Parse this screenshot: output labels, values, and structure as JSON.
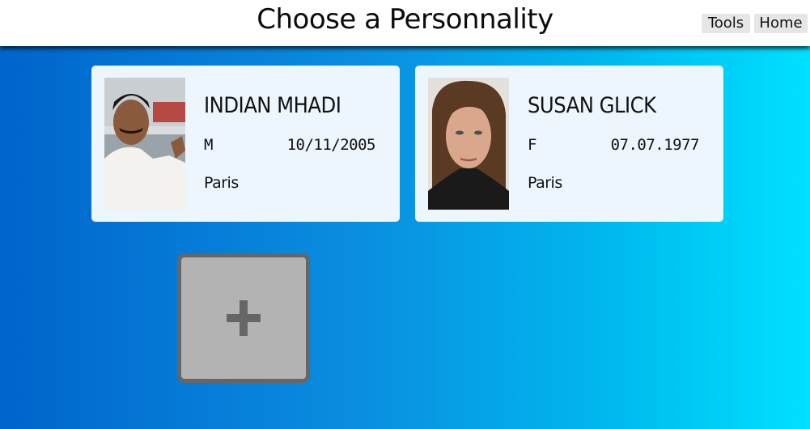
{
  "header": {
    "title": "Choose a Personnality",
    "nav": {
      "tools_label": "Tools",
      "home_label": "Home"
    }
  },
  "personalities": [
    {
      "name": "INDIAN MHADI",
      "sex": "M",
      "dob": "10/11/2005",
      "city": "Paris",
      "photo": "man-portrait"
    },
    {
      "name": "SUSAN GLICK",
      "sex": "F",
      "dob": "07.07.1977",
      "city": "Paris",
      "photo": "woman-portrait"
    }
  ],
  "add_tile": {
    "icon": "plus-icon"
  },
  "colors": {
    "header_bg": "#ffffff",
    "card_bg": "#edf5fd",
    "gradient_start": "#0064cc",
    "gradient_end": "#00e0ff",
    "add_tile_bg": "#b3b3b3",
    "add_tile_border": "#666666"
  }
}
